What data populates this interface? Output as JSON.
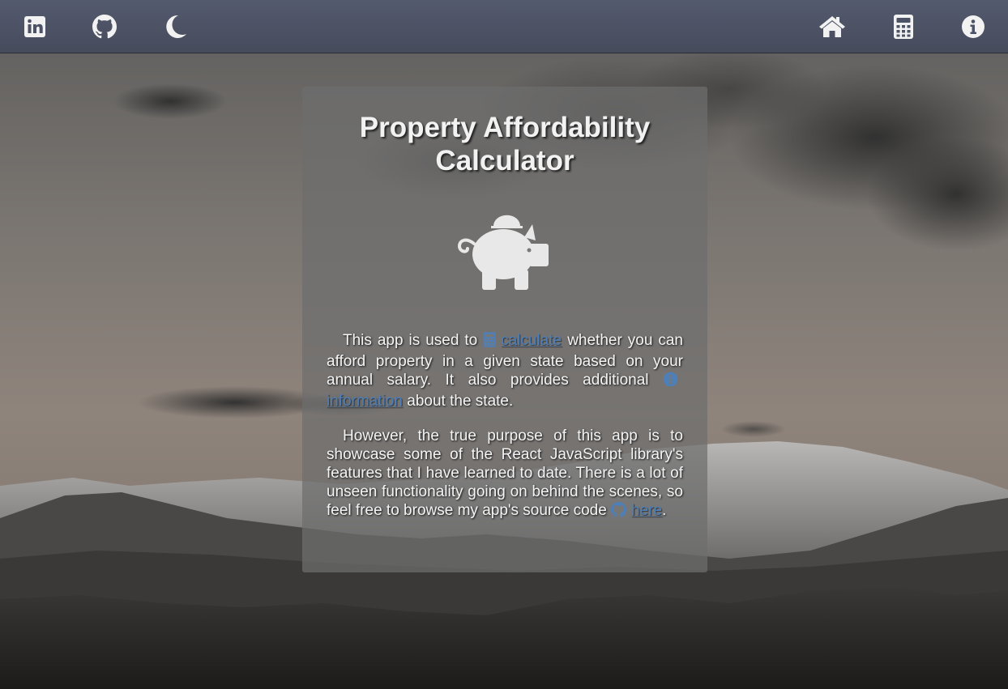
{
  "nav": {
    "left_icons": [
      "linkedin-icon",
      "github-icon",
      "moon-icon"
    ],
    "right_icons": [
      "home-icon",
      "calculator-icon",
      "info-icon"
    ]
  },
  "card": {
    "title_line1": "Property Affordability",
    "title_line2": "Calculator",
    "icon": "piggy-bank-icon",
    "para1": {
      "before_calc": "This app is used to ",
      "calc_link": "calculate",
      "after_calc": " whether you can afford property in a given state based on your annual salary. It also provides additional ",
      "info_link": "information",
      "after_info": " about the state."
    },
    "para2": {
      "text": "However, the true purpose of this app is to showcase some of the React JavaScript library's features that I have learned to date. There is a lot of unseen functionality going on behind the scenes, so feel free to browse my app's source code ",
      "here_link": "here",
      "end": "."
    }
  },
  "colors": {
    "navbar": "#4d5366",
    "card": "#6e6e6e",
    "link": "#4d7fb8",
    "text": "#f4f4f4"
  }
}
